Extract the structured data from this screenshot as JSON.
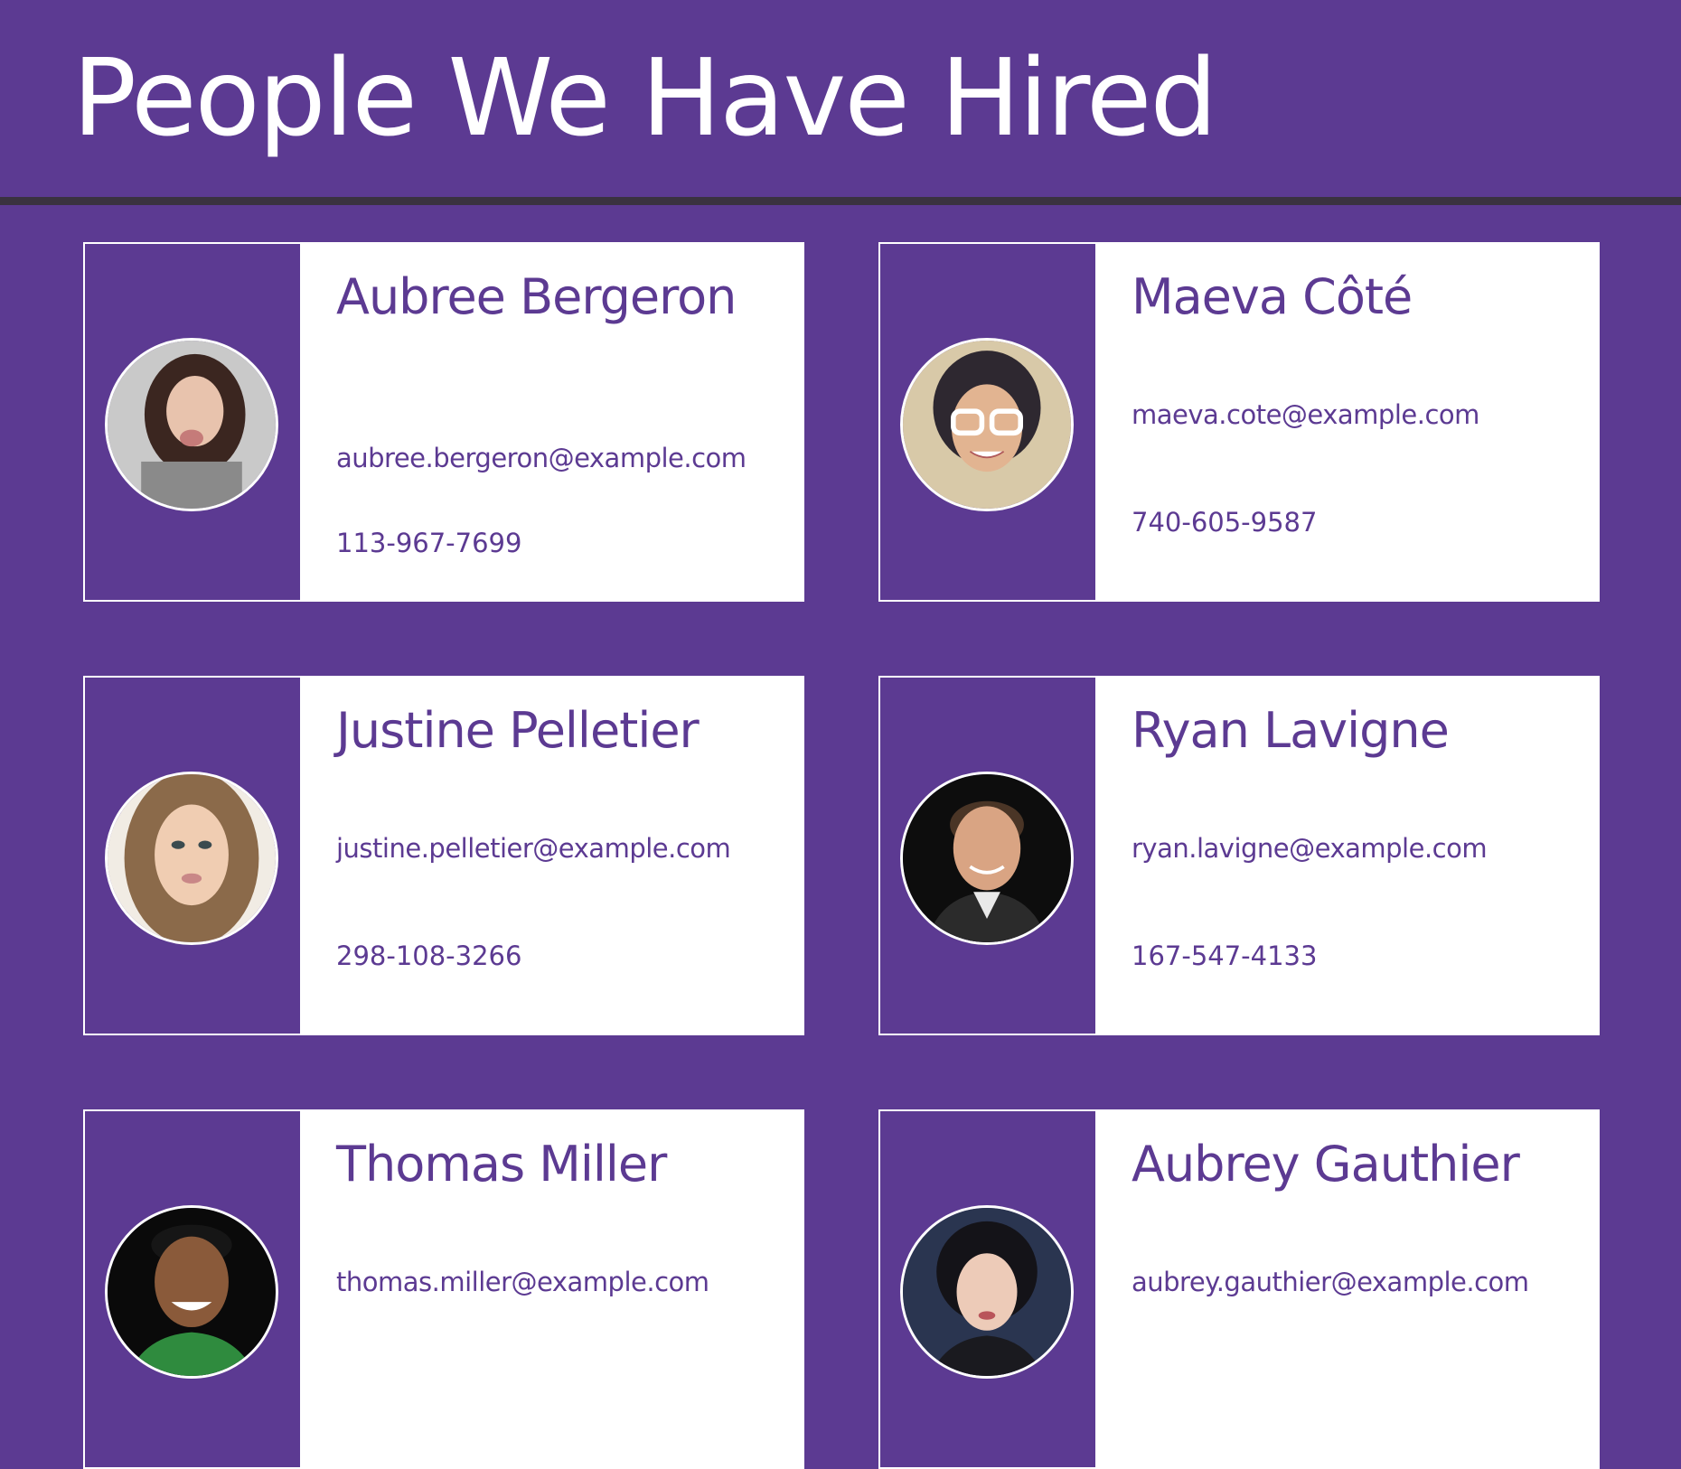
{
  "header": {
    "title": "People We Have Hired"
  },
  "hires": [
    {
      "name": "Aubree Bergeron",
      "email": "aubree.bergeron@example.com",
      "phone": "113-967-7699",
      "avatar_icon": "person-photo-avatar"
    },
    {
      "name": "Maeva Côté",
      "email": "maeva.cote@example.com",
      "phone": "740-605-9587",
      "avatar_icon": "person-photo-avatar"
    },
    {
      "name": "Justine Pelletier",
      "email": "justine.pelletier@example.com",
      "phone": "298-108-3266",
      "avatar_icon": "person-photo-avatar"
    },
    {
      "name": "Ryan Lavigne",
      "email": "ryan.lavigne@example.com",
      "phone": "167-547-4133",
      "avatar_icon": "person-photo-avatar"
    },
    {
      "name": "Thomas Miller",
      "email": "thomas.miller@example.com",
      "phone": "",
      "avatar_icon": "person-photo-avatar"
    },
    {
      "name": "Aubrey Gauthier",
      "email": "aubrey.gauthier@example.com",
      "phone": "",
      "avatar_icon": "person-photo-avatar"
    }
  ],
  "colors": {
    "brand_purple": "#5c3a92",
    "header_rule": "#3a3240",
    "card_background": "#ffffff"
  }
}
